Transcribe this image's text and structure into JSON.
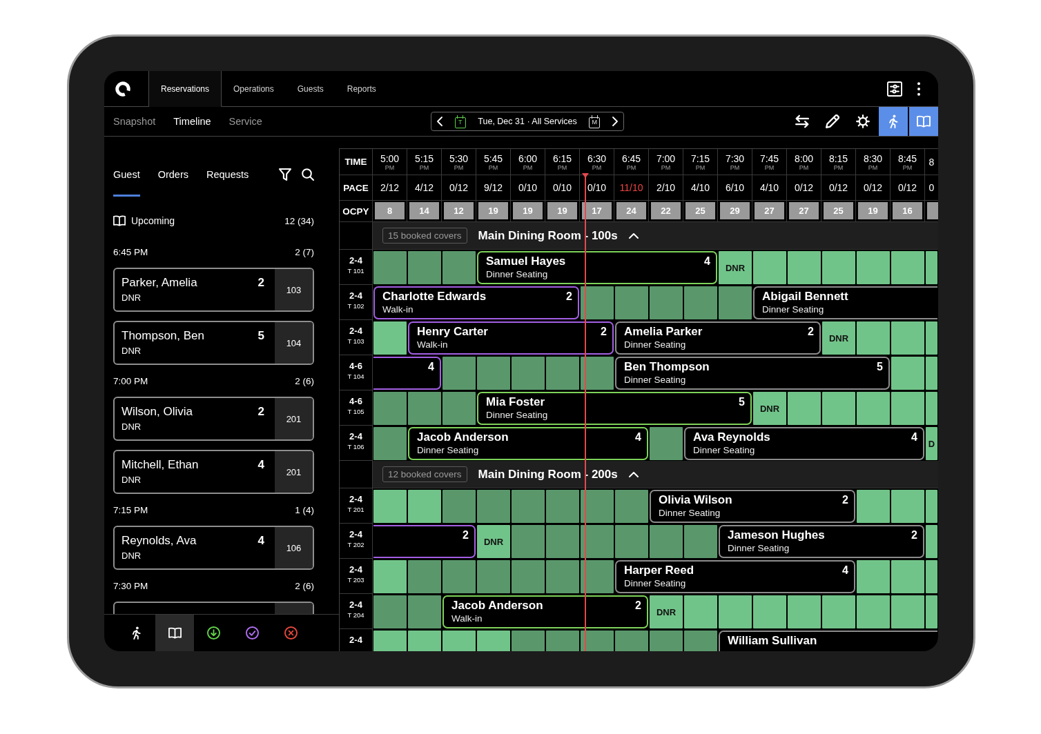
{
  "top_nav": {
    "tabs": [
      {
        "label": "Reservations",
        "selected": true
      },
      {
        "label": "Operations",
        "selected": false
      },
      {
        "label": "Guests",
        "selected": false
      },
      {
        "label": "Reports",
        "selected": false
      }
    ]
  },
  "view_tabs": [
    {
      "label": "Snapshot",
      "selected": false
    },
    {
      "label": "Timeline",
      "selected": true
    },
    {
      "label": "Service",
      "selected": false
    }
  ],
  "date_picker": {
    "today": "T",
    "date": "Tue, Dec 31 · All Services",
    "month": "M"
  },
  "toolbar": [
    {
      "kind": "swap",
      "selected": false
    },
    {
      "kind": "edit",
      "selected": false
    },
    {
      "kind": "settings",
      "selected": false
    },
    {
      "kind": "walkin",
      "selected": true
    },
    {
      "kind": "book",
      "selected": true
    }
  ],
  "sidebar": {
    "tabs": [
      {
        "label": "Guest",
        "selected": true
      },
      {
        "label": "Orders",
        "selected": false
      },
      {
        "label": "Requests",
        "selected": false
      }
    ],
    "list_title": "Upcoming",
    "list_count": "12 (34)",
    "groups": [
      {
        "time": "6:45 PM",
        "count": "2 (7)",
        "continues": false,
        "reservations": [
          {
            "name": "Parker, Amelia",
            "party": "2",
            "type": "DNR",
            "table": "103"
          },
          {
            "name": "Thompson, Ben",
            "party": "5",
            "type": "DNR",
            "table": "104"
          }
        ]
      },
      {
        "time": "7:00 PM",
        "count": "2 (6)",
        "continues": false,
        "reservations": [
          {
            "name": "Wilson, Olivia",
            "party": "2",
            "type": "DNR",
            "table": "201"
          },
          {
            "name": "Mitchell, Ethan",
            "party": "4",
            "type": "DNR",
            "table": "201"
          }
        ]
      },
      {
        "time": "7:15 PM",
        "count": "1 (4)",
        "continues": false,
        "reservations": [
          {
            "name": "Reynolds, Ava",
            "party": "4",
            "type": "DNR",
            "table": "106"
          }
        ]
      },
      {
        "time": "7:30 PM",
        "count": "2 (6)",
        "continues": true
      }
    ],
    "bottom_tabs": [
      {
        "kind": "walkin",
        "selected": false
      },
      {
        "kind": "book",
        "selected": true
      },
      {
        "kind": "arrived",
        "selected": false
      },
      {
        "kind": "done",
        "selected": false
      },
      {
        "kind": "cancelled",
        "selected": false
      }
    ]
  },
  "timeline": {
    "row_labels": {
      "time": "TIME",
      "pace": "PACE",
      "occupancy": "OCPY"
    },
    "columns": [
      {
        "time": "5:00",
        "period": "PM",
        "pace": "2/12",
        "over": false,
        "ocpy": "8",
        "now": false
      },
      {
        "time": "5:15",
        "period": "PM",
        "pace": "4/12",
        "over": false,
        "ocpy": "14",
        "now": false
      },
      {
        "time": "5:30",
        "period": "PM",
        "pace": "0/12",
        "over": false,
        "ocpy": "12",
        "now": false
      },
      {
        "time": "5:45",
        "period": "PM",
        "pace": "9/12",
        "over": false,
        "ocpy": "19",
        "now": false
      },
      {
        "time": "6:00",
        "period": "PM",
        "pace": "0/10",
        "over": false,
        "ocpy": "19",
        "now": false
      },
      {
        "time": "6:15",
        "period": "PM",
        "pace": "0/10",
        "over": false,
        "ocpy": "19",
        "now": false
      },
      {
        "time": "6:30",
        "period": "PM",
        "pace": "0/10",
        "over": false,
        "ocpy": "17",
        "now": true
      },
      {
        "time": "6:45",
        "period": "PM",
        "pace": "11/10",
        "over": true,
        "ocpy": "24",
        "now": false
      },
      {
        "time": "7:00",
        "period": "PM",
        "pace": "2/10",
        "over": false,
        "ocpy": "22",
        "now": false
      },
      {
        "time": "7:15",
        "period": "PM",
        "pace": "4/10",
        "over": false,
        "ocpy": "25",
        "now": false
      },
      {
        "time": "7:30",
        "period": "PM",
        "pace": "6/10",
        "over": false,
        "ocpy": "29",
        "now": false
      },
      {
        "time": "7:45",
        "period": "PM",
        "pace": "4/10",
        "over": false,
        "ocpy": "27",
        "now": false
      },
      {
        "time": "8:00",
        "period": "PM",
        "pace": "0/12",
        "over": false,
        "ocpy": "27",
        "now": false
      },
      {
        "time": "8:15",
        "period": "PM",
        "pace": "0/12",
        "over": false,
        "ocpy": "25",
        "now": false
      },
      {
        "time": "8:30",
        "period": "PM",
        "pace": "0/12",
        "over": false,
        "ocpy": "19",
        "now": false
      },
      {
        "time": "8:45",
        "period": "PM",
        "pace": "0/12",
        "over": false,
        "ocpy": "16",
        "now": false
      },
      {
        "time": "8",
        "pace": "0",
        "over": false,
        "now": false
      }
    ],
    "sections": [
      {
        "covers": "15 booked covers",
        "title": "Main Dining Room - 100s",
        "expanded": true,
        "rows": [
          {
            "size": "2-4",
            "table": "T 101",
            "slots": [
              {
                "kind": "dark"
              },
              {
                "kind": "dark"
              },
              {
                "kind": "dark"
              },
              {
                "kind": "booking",
                "name": "Samuel Hayes",
                "party": "4",
                "type": "Dinner Seating",
                "color": "#7ed35a"
              },
              {
                "kind": "cont"
              },
              {
                "kind": "cont"
              },
              {
                "kind": "cont"
              },
              {
                "kind": "cont"
              },
              {
                "kind": "cont"
              },
              {
                "kind": "cont"
              },
              {
                "kind": "dnr",
                "label": "DNR"
              },
              {
                "kind": "light"
              },
              {
                "kind": "light"
              },
              {
                "kind": "light"
              },
              {
                "kind": "light"
              },
              {
                "kind": "light"
              },
              {
                "kind": "light"
              }
            ]
          },
          {
            "size": "2-4",
            "table": "T 102",
            "slots": [
              {
                "kind": "booking",
                "name": "Charlotte Edwards",
                "party": "2",
                "type": "Walk-in",
                "color": "#a35fe3"
              },
              {
                "kind": "cont"
              },
              {
                "kind": "cont"
              },
              {
                "kind": "cont"
              },
              {
                "kind": "cont"
              },
              {
                "kind": "cont"
              },
              {
                "kind": "dark"
              },
              {
                "kind": "dark"
              },
              {
                "kind": "dark"
              },
              {
                "kind": "dark"
              },
              {
                "kind": "dark"
              },
              {
                "kind": "booking",
                "name": "Abigail Bennett",
                "type": "Dinner Seating",
                "color": "#8c8c8c"
              },
              {
                "kind": "cont"
              },
              {
                "kind": "cont"
              },
              {
                "kind": "cont"
              },
              {
                "kind": "cont"
              },
              {
                "kind": "cont"
              }
            ]
          },
          {
            "size": "2-4",
            "table": "T 103",
            "slots": [
              {
                "kind": "light"
              },
              {
                "kind": "booking",
                "name": "Henry Carter",
                "party": "2",
                "type": "Walk-in",
                "color": "#a35fe3"
              },
              {
                "kind": "cont"
              },
              {
                "kind": "cont"
              },
              {
                "kind": "cont"
              },
              {
                "kind": "cont"
              },
              {
                "kind": "cont"
              },
              {
                "kind": "booking",
                "name": "Amelia Parker",
                "party": "2",
                "type": "Dinner Seating",
                "color": "#8c8c8c"
              },
              {
                "kind": "cont"
              },
              {
                "kind": "cont"
              },
              {
                "kind": "cont"
              },
              {
                "kind": "cont"
              },
              {
                "kind": "cont"
              },
              {
                "kind": "dnr",
                "label": "DNR"
              },
              {
                "kind": "light"
              },
              {
                "kind": "light"
              },
              {
                "kind": "light"
              }
            ]
          },
          {
            "size": "4-6",
            "table": "T 104",
            "slots": [
              {
                "kind": "tail",
                "party": "4",
                "color": "#a35fe3"
              },
              {
                "kind": "cont"
              },
              {
                "kind": "dark"
              },
              {
                "kind": "dark"
              },
              {
                "kind": "dark"
              },
              {
                "kind": "dark"
              },
              {
                "kind": "dark"
              },
              {
                "kind": "booking",
                "name": "Ben Thompson",
                "party": "5",
                "type": "Dinner Seating",
                "color": "#8c8c8c"
              },
              {
                "kind": "cont"
              },
              {
                "kind": "cont"
              },
              {
                "kind": "cont"
              },
              {
                "kind": "cont"
              },
              {
                "kind": "cont"
              },
              {
                "kind": "cont"
              },
              {
                "kind": "cont"
              },
              {
                "kind": "light"
              },
              {
                "kind": "light"
              }
            ]
          },
          {
            "size": "4-6",
            "table": "T 105",
            "slots": [
              {
                "kind": "dark"
              },
              {
                "kind": "dark"
              },
              {
                "kind": "dark"
              },
              {
                "kind": "booking",
                "name": "Mia Foster",
                "party": "5",
                "type": "Dinner Seating",
                "color": "#7ed35a"
              },
              {
                "kind": "cont"
              },
              {
                "kind": "cont"
              },
              {
                "kind": "cont"
              },
              {
                "kind": "cont"
              },
              {
                "kind": "cont"
              },
              {
                "kind": "cont"
              },
              {
                "kind": "cont"
              },
              {
                "kind": "dnr",
                "label": "DNR"
              },
              {
                "kind": "light"
              },
              {
                "kind": "light"
              },
              {
                "kind": "light"
              },
              {
                "kind": "light"
              },
              {
                "kind": "light"
              }
            ]
          },
          {
            "size": "2-4",
            "table": "T 106",
            "slots": [
              {
                "kind": "dark"
              },
              {
                "kind": "booking",
                "name": "Jacob Anderson",
                "party": "4",
                "type": "Dinner Seating",
                "color": "#7ed35a"
              },
              {
                "kind": "cont"
              },
              {
                "kind": "cont"
              },
              {
                "kind": "cont"
              },
              {
                "kind": "cont"
              },
              {
                "kind": "cont"
              },
              {
                "kind": "cont"
              },
              {
                "kind": "dark"
              },
              {
                "kind": "booking",
                "name": "Ava Reynolds",
                "party": "4",
                "type": "Dinner Seating",
                "color": "#8c8c8c"
              },
              {
                "kind": "cont"
              },
              {
                "kind": "cont"
              },
              {
                "kind": "cont"
              },
              {
                "kind": "cont"
              },
              {
                "kind": "cont"
              },
              {
                "kind": "cont"
              },
              {
                "kind": "dnr",
                "label": "D"
              }
            ]
          }
        ]
      },
      {
        "covers": "12 booked covers",
        "title": "Main Dining Room - 200s",
        "expanded": true,
        "rows": [
          {
            "size": "2-4",
            "table": "T 201",
            "slots": [
              {
                "kind": "light"
              },
              {
                "kind": "light"
              },
              {
                "kind": "dark"
              },
              {
                "kind": "dark"
              },
              {
                "kind": "dark"
              },
              {
                "kind": "dark"
              },
              {
                "kind": "dark"
              },
              {
                "kind": "dark"
              },
              {
                "kind": "booking",
                "name": "Olivia Wilson",
                "party": "2",
                "type": "Dinner Seating",
                "color": "#8c8c8c"
              },
              {
                "kind": "cont"
              },
              {
                "kind": "cont"
              },
              {
                "kind": "cont"
              },
              {
                "kind": "cont"
              },
              {
                "kind": "cont"
              },
              {
                "kind": "light"
              },
              {
                "kind": "light"
              },
              {
                "kind": "light"
              }
            ]
          },
          {
            "size": "2-4",
            "table": "T 202",
            "slots": [
              {
                "kind": "tail",
                "party": "2",
                "color": "#a35fe3"
              },
              {
                "kind": "cont"
              },
              {
                "kind": "cont"
              },
              {
                "kind": "dnr",
                "label": "DNR"
              },
              {
                "kind": "dark"
              },
              {
                "kind": "dark"
              },
              {
                "kind": "dark"
              },
              {
                "kind": "dark"
              },
              {
                "kind": "dark"
              },
              {
                "kind": "dark"
              },
              {
                "kind": "booking",
                "name": "Jameson Hughes",
                "party": "2",
                "type": "Dinner Seating",
                "color": "#8c8c8c"
              },
              {
                "kind": "cont"
              },
              {
                "kind": "cont"
              },
              {
                "kind": "cont"
              },
              {
                "kind": "cont"
              },
              {
                "kind": "cont"
              },
              {
                "kind": "light"
              }
            ]
          },
          {
            "size": "2-4",
            "table": "T 203",
            "slots": [
              {
                "kind": "light"
              },
              {
                "kind": "dark"
              },
              {
                "kind": "dark"
              },
              {
                "kind": "dark"
              },
              {
                "kind": "dark"
              },
              {
                "kind": "dark"
              },
              {
                "kind": "dark"
              },
              {
                "kind": "booking",
                "name": "Harper Reed",
                "party": "4",
                "type": "Dinner Seating",
                "color": "#8c8c8c"
              },
              {
                "kind": "cont"
              },
              {
                "kind": "cont"
              },
              {
                "kind": "cont"
              },
              {
                "kind": "cont"
              },
              {
                "kind": "cont"
              },
              {
                "kind": "cont"
              },
              {
                "kind": "light"
              },
              {
                "kind": "light"
              },
              {
                "kind": "light"
              }
            ]
          },
          {
            "size": "2-4",
            "table": "T 204",
            "slots": [
              {
                "kind": "dark"
              },
              {
                "kind": "dark"
              },
              {
                "kind": "booking",
                "name": "Jacob Anderson",
                "party": "2",
                "type": "Walk-in",
                "color": "#7ed35a"
              },
              {
                "kind": "cont"
              },
              {
                "kind": "cont"
              },
              {
                "kind": "cont"
              },
              {
                "kind": "cont"
              },
              {
                "kind": "cont"
              },
              {
                "kind": "dnr",
                "label": "DNR"
              },
              {
                "kind": "light"
              },
              {
                "kind": "light"
              },
              {
                "kind": "light"
              },
              {
                "kind": "light"
              },
              {
                "kind": "light"
              },
              {
                "kind": "light"
              },
              {
                "kind": "light"
              },
              {
                "kind": "light"
              }
            ]
          },
          {
            "size": "2-4",
            "slots": [
              {
                "kind": "light"
              },
              {
                "kind": "light"
              },
              {
                "kind": "light"
              },
              {
                "kind": "light"
              },
              {
                "kind": "dark"
              },
              {
                "kind": "dark"
              },
              {
                "kind": "dark"
              },
              {
                "kind": "dark"
              },
              {
                "kind": "dark"
              },
              {
                "kind": "dark"
              },
              {
                "kind": "booking",
                "name": "William Sullivan",
                "color": "#8c8c8c"
              },
              {
                "kind": "cont"
              },
              {
                "kind": "cont"
              },
              {
                "kind": "cont"
              },
              {
                "kind": "cont"
              },
              {
                "kind": "cont"
              },
              {
                "kind": "cont"
              }
            ]
          }
        ]
      }
    ]
  }
}
